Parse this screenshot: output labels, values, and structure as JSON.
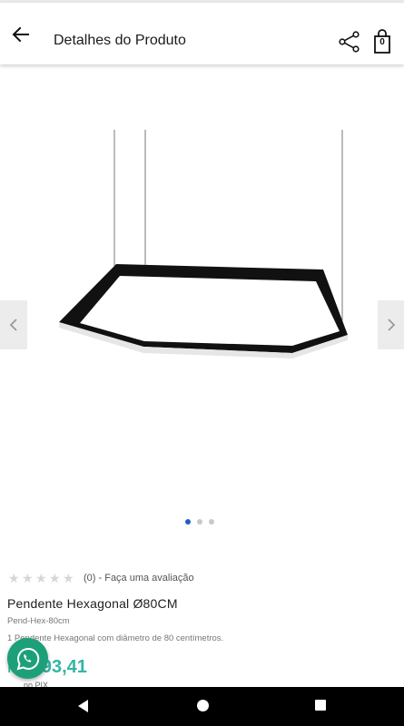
{
  "header": {
    "title": "Detalhes do Produto",
    "cart_count": "0"
  },
  "gallery": {
    "image_count": 3,
    "active_index": 0
  },
  "product": {
    "rating_text": "(0) - Faça uma avaliação",
    "stars_filled": 0,
    "stars_total": 5,
    "name": "Pendente Hexagonal Ø80CM",
    "sku": "Pend-Hex-80cm",
    "description": "1 Pendente Hexagonal com diâmetro de 80 centímetros.",
    "price_currency": "R$",
    "price_value": "693,41",
    "price_note": "no PIX"
  },
  "colors": {
    "accent_price": "#33b5a6",
    "whatsapp": "#1da07a",
    "dot_active": "#1f5fc7"
  },
  "icons": [
    "back-arrow-icon",
    "share-icon",
    "shopping-bag-icon",
    "chevron-left-icon",
    "chevron-right-icon",
    "star-icon",
    "whatsapp-icon",
    "nav-back-icon",
    "nav-home-icon",
    "nav-recents-icon"
  ]
}
